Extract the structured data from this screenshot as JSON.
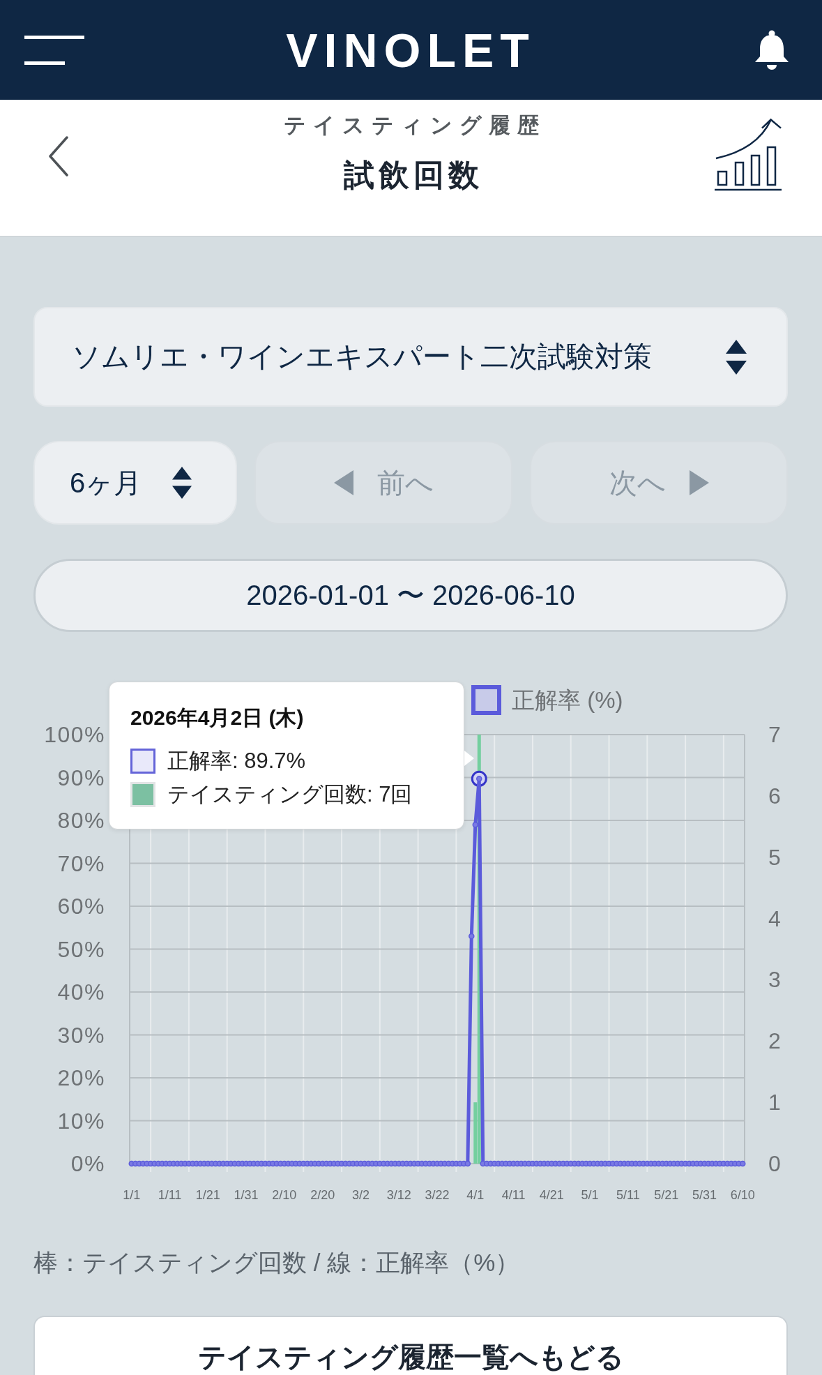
{
  "header": {
    "logo": "VINOLET"
  },
  "page_title": {
    "section": "テイスティング履歴",
    "title": "試飲回数"
  },
  "course_select": {
    "value": "ソムリエ・ワインエキスパート二次試験対策"
  },
  "period_select": {
    "value": "6ヶ月"
  },
  "nav_buttons": [
    {
      "label": "前へ",
      "kind": "prev",
      "disabled": true
    },
    {
      "label": "次へ",
      "kind": "next",
      "disabled": true
    }
  ],
  "date_range": {
    "value": "2026-01-01 〜 2026-06-10"
  },
  "chart": {
    "tooltip": {
      "title": "2026年4月2日 (木)",
      "rows": [
        {
          "label": "正解率: 89.7%",
          "kind": "line",
          "color": "#6464d8"
        },
        {
          "label": "テイスティング回数: 7回",
          "kind": "bar",
          "color": "#7cc0a2"
        }
      ]
    },
    "chart_data": {
      "type": "bar",
      "grid": true,
      "categories": [
        "1/1",
        null,
        null,
        null,
        null,
        null,
        null,
        null,
        null,
        null,
        "1/11",
        null,
        null,
        null,
        null,
        null,
        null,
        null,
        null,
        null,
        "1/21",
        null,
        null,
        null,
        null,
        null,
        null,
        null,
        null,
        null,
        "1/31",
        null,
        null,
        null,
        null,
        null,
        null,
        null,
        null,
        null,
        "2/10",
        null,
        null,
        null,
        null,
        null,
        null,
        null,
        null,
        null,
        "2/20",
        null,
        null,
        null,
        null,
        null,
        null,
        null,
        null,
        null,
        "3/2",
        null,
        null,
        null,
        null,
        null,
        null,
        null,
        null,
        null,
        "3/12",
        null,
        null,
        null,
        null,
        null,
        null,
        null,
        null,
        null,
        "3/22",
        null,
        null,
        null,
        null,
        null,
        null,
        null,
        null,
        null,
        "4/1",
        null,
        null,
        null,
        null,
        null,
        null,
        null,
        null,
        null,
        "4/11",
        null,
        null,
        null,
        null,
        null,
        null,
        null,
        null,
        null,
        "4/21",
        null,
        null,
        null,
        null,
        null,
        null,
        null,
        null,
        null,
        "5/1",
        null,
        null,
        null,
        null,
        null,
        null,
        null,
        null,
        null,
        "5/11",
        null,
        null,
        null,
        null,
        null,
        null,
        null,
        null,
        null,
        "5/21",
        null,
        null,
        null,
        null,
        null,
        null,
        null,
        null,
        null,
        "5/31",
        null,
        null,
        null,
        null,
        null,
        null,
        null,
        null,
        null,
        "6/10"
      ],
      "ylim": [
        0,
        100
      ],
      "yticks": [
        {
          "value": 0,
          "label": "0%"
        },
        {
          "value": 10,
          "label": "10%"
        },
        {
          "value": 20,
          "label": "20%"
        },
        {
          "value": 30,
          "label": "30%"
        },
        {
          "value": 40,
          "label": "40%"
        },
        {
          "value": 50,
          "label": "50%"
        },
        {
          "value": 60,
          "label": "60%"
        },
        {
          "value": 70,
          "label": "70%"
        },
        {
          "value": 80,
          "label": "80%"
        },
        {
          "value": 90,
          "label": "90%"
        },
        {
          "value": 100,
          "label": "100%"
        }
      ],
      "y2lim": [
        0,
        7
      ],
      "y2ticks": [
        0,
        1,
        2,
        3,
        4,
        5,
        6,
        7
      ],
      "series": [
        {
          "axis": "y2",
          "color": "#74cf9f",
          "values": [
            0,
            0,
            0,
            0,
            0,
            0,
            0,
            0,
            0,
            0,
            0,
            0,
            0,
            0,
            0,
            0,
            0,
            0,
            0,
            0,
            0,
            0,
            0,
            0,
            0,
            0,
            0,
            0,
            0,
            0,
            0,
            0,
            0,
            0,
            0,
            0,
            0,
            0,
            0,
            0,
            0,
            0,
            0,
            0,
            0,
            0,
            0,
            0,
            0,
            0,
            0,
            0,
            0,
            0,
            0,
            0,
            0,
            0,
            0,
            0,
            0,
            0,
            0,
            0,
            0,
            0,
            0,
            0,
            0,
            0,
            0,
            0,
            0,
            0,
            0,
            0,
            0,
            0,
            0,
            0,
            0,
            0,
            0,
            0,
            0,
            0,
            0,
            0,
            0,
            0,
            1,
            7,
            0,
            0,
            0,
            0,
            0,
            0,
            0,
            0,
            0,
            0,
            0,
            0,
            0,
            0,
            0,
            0,
            0,
            0,
            0,
            0,
            0,
            0,
            0,
            0,
            0,
            0,
            0,
            0,
            0,
            0,
            0,
            0,
            0,
            0,
            0,
            0,
            0,
            0,
            0,
            0,
            0,
            0,
            0,
            0,
            0,
            0,
            0,
            0,
            0,
            0,
            0,
            0,
            0,
            0,
            0,
            0,
            0,
            0,
            0,
            0,
            0,
            0,
            0,
            0,
            0,
            0,
            0,
            0,
            0
          ]
        },
        {
          "type": "line",
          "name": "正解率 (%)",
          "color": "#5b5bdb",
          "marker": "circle",
          "values": [
            0,
            0,
            0,
            0,
            0,
            0,
            0,
            0,
            0,
            0,
            0,
            0,
            0,
            0,
            0,
            0,
            0,
            0,
            0,
            0,
            0,
            0,
            0,
            0,
            0,
            0,
            0,
            0,
            0,
            0,
            0,
            0,
            0,
            0,
            0,
            0,
            0,
            0,
            0,
            0,
            0,
            0,
            0,
            0,
            0,
            0,
            0,
            0,
            0,
            0,
            0,
            0,
            0,
            0,
            0,
            0,
            0,
            0,
            0,
            0,
            0,
            0,
            0,
            0,
            0,
            0,
            0,
            0,
            0,
            0,
            0,
            0,
            0,
            0,
            0,
            0,
            0,
            0,
            0,
            0,
            0,
            0,
            0,
            0,
            0,
            0,
            0,
            0,
            0,
            53,
            79,
            89.7,
            0,
            0,
            0,
            0,
            0,
            0,
            0,
            0,
            0,
            0,
            0,
            0,
            0,
            0,
            0,
            0,
            0,
            0,
            0,
            0,
            0,
            0,
            0,
            0,
            0,
            0,
            0,
            0,
            0,
            0,
            0,
            0,
            0,
            0,
            0,
            0,
            0,
            0,
            0,
            0,
            0,
            0,
            0,
            0,
            0,
            0,
            0,
            0,
            0,
            0,
            0,
            0,
            0,
            0,
            0,
            0,
            0,
            0,
            0,
            0,
            0,
            0,
            0,
            0,
            0,
            0,
            0,
            0,
            0
          ]
        }
      ]
    }
  },
  "caption": "棒：テイスティング回数 / 線：正解率（%）",
  "back_button": {
    "label": "テイスティング履歴一覧へもどる"
  }
}
